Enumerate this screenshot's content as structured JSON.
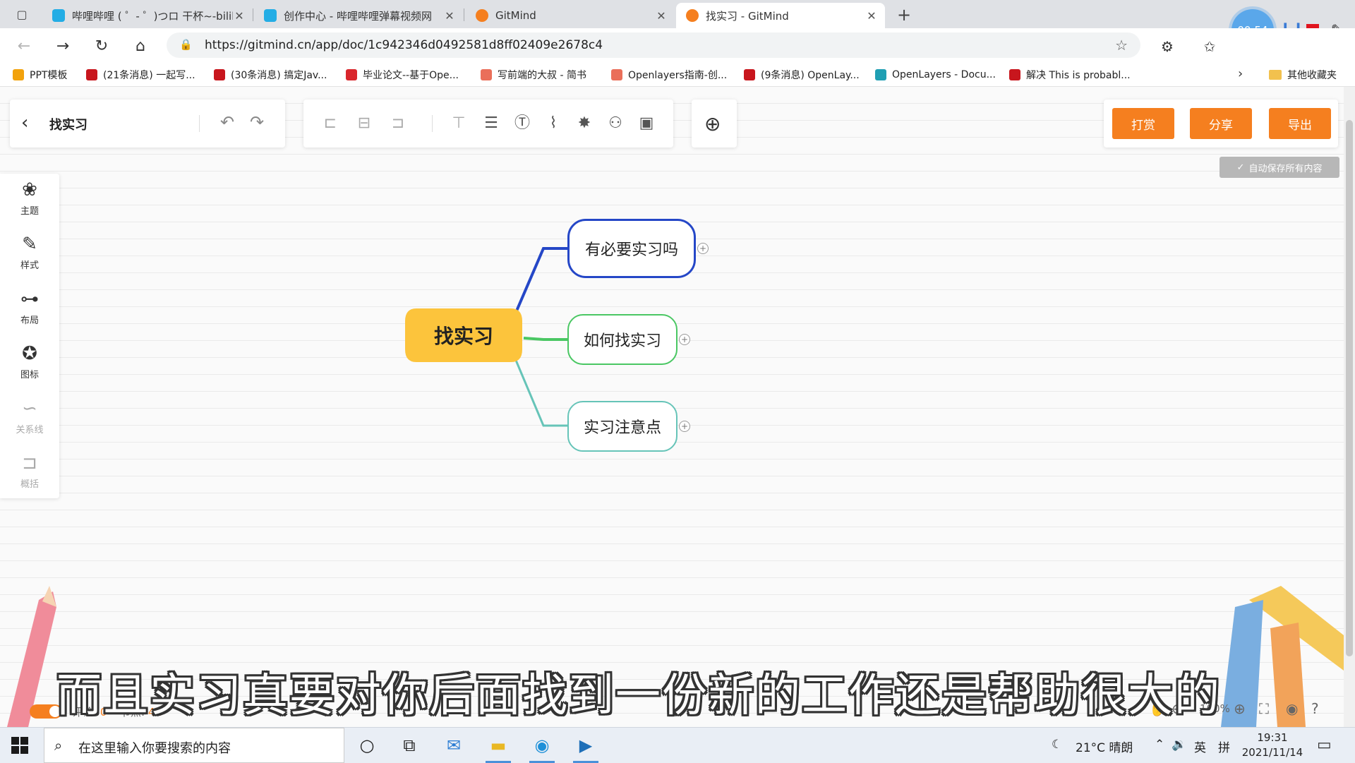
{
  "browser": {
    "tabs": [
      {
        "title": "哔哩哔哩 ( ゜- ゜)つロ 干杯~-bilibili",
        "favicon_color": "#23ade5"
      },
      {
        "title": "创作中心 - 哔哩哔哩弹幕视频网",
        "favicon_color": "#23ade5"
      },
      {
        "title": "GitMind",
        "favicon_color": "#f57f1f"
      },
      {
        "title": "找实习 - GitMind",
        "favicon_color": "#f57f1f",
        "active": true
      }
    ],
    "url": "https://gitmind.cn/app/doc/1c942346d0492581d8ff02409e2678c4",
    "recording_time": "00:54",
    "bookmarks": [
      {
        "label": "PPT模板",
        "color": "#f2a20c"
      },
      {
        "label": "(21条消息) 一起写...",
        "color": "#c8161d"
      },
      {
        "label": "(30条消息) 搞定Jav...",
        "color": "#c8161d"
      },
      {
        "label": "毕业论文--基于Ope...",
        "color": "#d9262c"
      },
      {
        "label": "写前端的大叔 - 简书",
        "color": "#ea6f5a"
      },
      {
        "label": "Openlayers指南-创...",
        "color": "#ea6f5a"
      },
      {
        "label": "(9条消息) OpenLay...",
        "color": "#c8161d"
      },
      {
        "label": "OpenLayers - Docu...",
        "color": "#1f9fb3"
      },
      {
        "label": "解决 This is probabl...",
        "color": "#c8161d"
      }
    ],
    "other_bookmarks": "其他收藏夹"
  },
  "app": {
    "doc_title": "找实习",
    "buttons": {
      "reward": "打赏",
      "share": "分享",
      "export": "导出"
    },
    "autosave": "自动保存所有内容",
    "sidebar": [
      {
        "label": "主题",
        "icon": "theme-icon",
        "glyph": "❀"
      },
      {
        "label": "样式",
        "icon": "style-icon",
        "glyph": "✎"
      },
      {
        "label": "布局",
        "icon": "layout-icon",
        "glyph": "⊶"
      },
      {
        "label": "图标",
        "icon": "emoji-icon",
        "glyph": "✪"
      },
      {
        "label": "关系线",
        "icon": "relation-icon",
        "glyph": "∽",
        "dim": true
      },
      {
        "label": "概括",
        "icon": "summary-icon",
        "glyph": "⊐",
        "dim": true
      }
    ],
    "mindmap": {
      "root": {
        "label": "找实习",
        "color": "#fcc43c"
      },
      "children": [
        {
          "label": "有必要实习吗",
          "color": "#2547c7"
        },
        {
          "label": "如何找实习",
          "color": "#4ac763"
        },
        {
          "label": "实习注意点",
          "color": "#66c4b8"
        }
      ]
    },
    "status": {
      "comments_label": "评论:",
      "comments": "0",
      "nodes_label": "节点:",
      "nodes": "41",
      "zoom": "100%"
    }
  },
  "subtitle": "而且实习真要对你后面找到一份新的工作还是帮助很大的",
  "taskbar": {
    "search_placeholder": "在这里输入你要搜索的内容",
    "weather": "21°C 晴朗",
    "ime_lang": "英",
    "ime_mode": "拼",
    "time": "19:31",
    "date": "2021/11/14"
  }
}
